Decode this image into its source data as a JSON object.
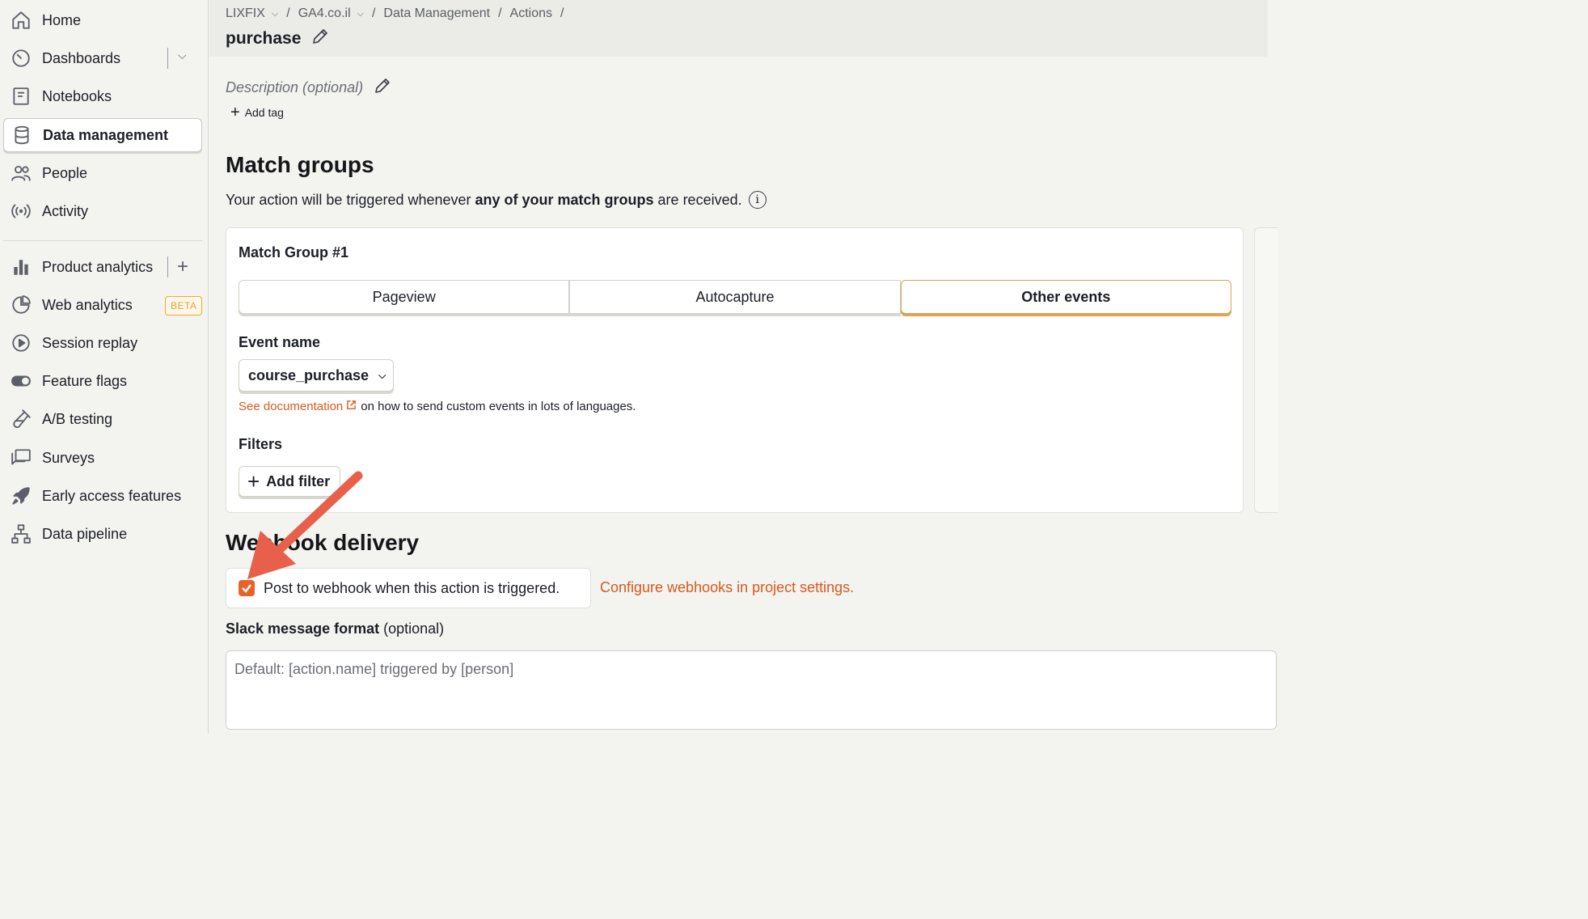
{
  "sidebar": {
    "items": [
      {
        "label": "Home",
        "icon": "home-icon"
      },
      {
        "label": "Dashboards",
        "icon": "dashboard-gauge-icon"
      },
      {
        "label": "Notebooks",
        "icon": "notebook-icon"
      },
      {
        "label": "Data management",
        "icon": "database-icon",
        "active": true
      },
      {
        "label": "People",
        "icon": "people-icon"
      },
      {
        "label": "Activity",
        "icon": "activity-broadcast-icon"
      },
      {
        "label": "Product analytics",
        "icon": "bar-chart-icon"
      },
      {
        "label": "Web analytics",
        "icon": "pie-chart-icon",
        "badge": "BETA"
      },
      {
        "label": "Session replay",
        "icon": "play-circle-icon"
      },
      {
        "label": "Feature flags",
        "icon": "toggle-icon"
      },
      {
        "label": "A/B testing",
        "icon": "flask-icon"
      },
      {
        "label": "Surveys",
        "icon": "survey-chat-icon"
      },
      {
        "label": "Early access features",
        "icon": "rocket-icon"
      },
      {
        "label": "Data pipeline",
        "icon": "pipeline-icon"
      }
    ]
  },
  "breadcrumbs": [
    {
      "label": "LIXFIX",
      "dropdown": true
    },
    {
      "label": "GA4.co.il",
      "dropdown": true
    },
    {
      "label": "Data Management",
      "dropdown": false
    },
    {
      "label": "Actions",
      "dropdown": false
    }
  ],
  "page": {
    "title": "purchase",
    "description_placeholder": "Description (optional)",
    "add_tag_label": "Add tag"
  },
  "match_groups": {
    "heading": "Match groups",
    "subtext_prefix": "Your action will be triggered whenever",
    "subtext_bold": "any of your match groups",
    "subtext_suffix": "are received.",
    "group": {
      "title": "Match Group #1",
      "tabs": [
        "Pageview",
        "Autocapture",
        "Other events"
      ],
      "active_tab": "Other events",
      "event_name_label": "Event name",
      "event_name_value": "course_purchase",
      "doc_link": "See documentation",
      "doc_suffix": "on how to send custom events in lots of languages.",
      "filters_label": "Filters",
      "add_filter_label": "Add filter"
    }
  },
  "webhook": {
    "heading": "Webhook delivery",
    "checkbox_label": "Post to webhook when this action is triggered.",
    "checked": true,
    "config_link": "Configure webhooks in project settings.",
    "slack_label_bold": "Slack message format",
    "slack_label_suffix": "(optional)",
    "slack_placeholder": "Default: [action.name] triggered by [person]"
  },
  "colors": {
    "accent": "#e6632a",
    "link": "#d85a1c",
    "active_tab_border": "#e2a44a",
    "annotation_arrow": "#e8604a"
  }
}
